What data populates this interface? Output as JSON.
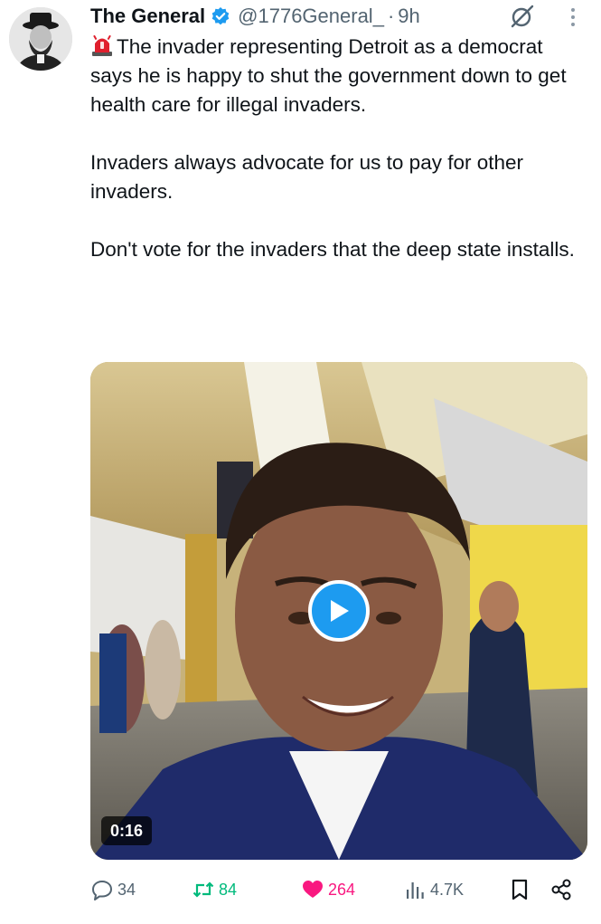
{
  "tweet": {
    "author_name": "The General",
    "handle": "@1776General_",
    "separator": "·",
    "time": "9h",
    "paragraphs": [
      "The invader representing Detroit as a democrat says he is happy to shut the government down to get health care for illegal invaders.",
      "Invaders always advocate for us to pay for other invaders.",
      "Don't vote for the invaders that the deep state installs."
    ],
    "lead_emoji": "police-siren-icon"
  },
  "media": {
    "duration": "0:16",
    "play_icon": "play-icon"
  },
  "actions": {
    "replies": "34",
    "retweets": "84",
    "likes": "264",
    "views": "4.7K"
  },
  "colors": {
    "verified": "#1d9bf0",
    "retweet": "#00ba7c",
    "like": "#f91880",
    "secondary_text": "#536471",
    "play_button": "#1d9bf0"
  }
}
